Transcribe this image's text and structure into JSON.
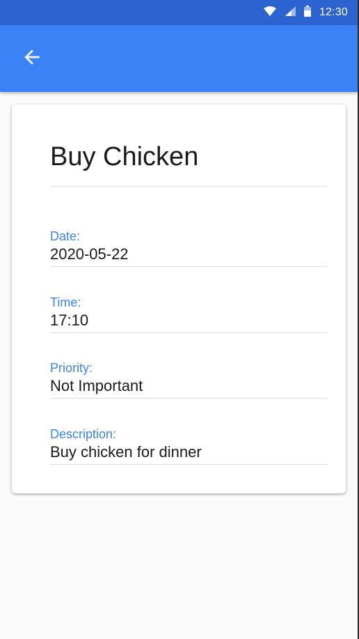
{
  "status_bar": {
    "time": "12:30",
    "icons": [
      "wifi-icon",
      "signal-icon",
      "battery-icon"
    ]
  },
  "app_bar": {
    "back_icon": "arrow-left-icon"
  },
  "task": {
    "title": "Buy Chicken",
    "fields": [
      {
        "label": "Date:",
        "value": "2020-05-22"
      },
      {
        "label": "Time:",
        "value": "17:10"
      },
      {
        "label": "Priority:",
        "value": "Not Important"
      },
      {
        "label": "Description:",
        "value": "Buy chicken for dinner"
      }
    ]
  },
  "colors": {
    "primary": "#3b82f6",
    "status_bar": "#2c63d0",
    "label": "#3b82f6",
    "text": "#1a1a1a",
    "divider": "#dcdcdc"
  }
}
